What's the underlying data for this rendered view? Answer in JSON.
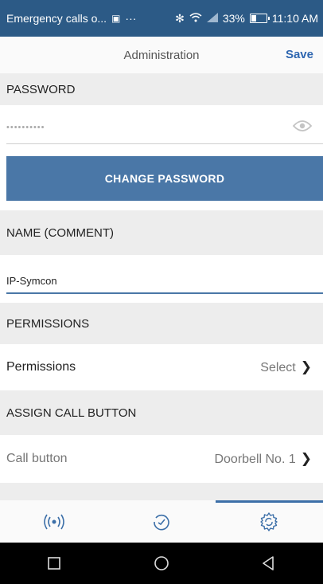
{
  "statusbar": {
    "notification": "Emergency calls o...",
    "battery": "33%",
    "time": "11:10 AM"
  },
  "appbar": {
    "title": "Administration",
    "save_label": "Save"
  },
  "password": {
    "section_label": "PASSWORD",
    "value": "••••••••••",
    "change_button": "CHANGE PASSWORD"
  },
  "name": {
    "section_label": "NAME (COMMENT)",
    "value": "IP-Symcon"
  },
  "permissions": {
    "section_label": "PERMISSIONS",
    "row_label": "Permissions",
    "row_value": "Select"
  },
  "call_button": {
    "section_label": "ASSIGN CALL BUTTON",
    "row_label": "Call button",
    "row_value": "Doorbell No. 1"
  },
  "bottom_nav": {
    "tabs": [
      {
        "icon": "broadcast-icon"
      },
      {
        "icon": "history-icon"
      },
      {
        "icon": "settings-gear-icon"
      }
    ],
    "active_index": 2
  },
  "system_nav": {
    "icons": [
      "recent-apps-icon",
      "home-icon",
      "back-icon"
    ]
  },
  "colors": {
    "status_bar": "#2c5a86",
    "button": "#4a77a7",
    "accent": "#2e66b0",
    "section_bg": "#ededed"
  }
}
